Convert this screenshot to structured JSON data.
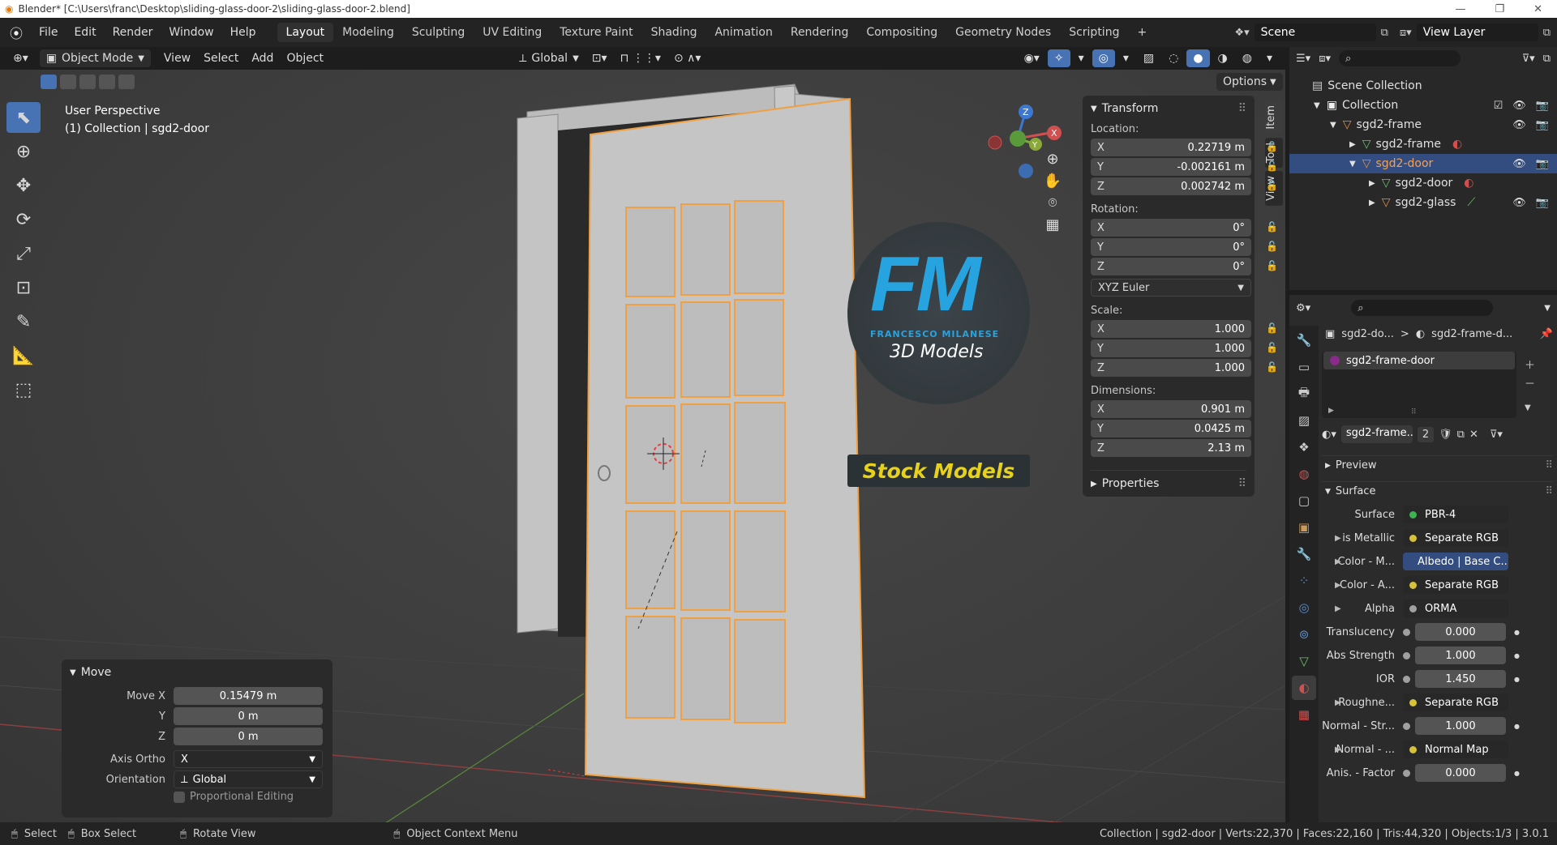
{
  "title_bar": {
    "text": "Blender* [C:\\Users\\franc\\Desktop\\sliding-glass-door-2\\sliding-glass-door-2.blend]",
    "minimize": "—",
    "maximize": "❐",
    "close": "✕"
  },
  "menu": [
    "File",
    "Edit",
    "Render",
    "Window",
    "Help"
  ],
  "workspaces": [
    "Layout",
    "Modeling",
    "Sculpting",
    "UV Editing",
    "Texture Paint",
    "Shading",
    "Animation",
    "Rendering",
    "Compositing",
    "Geometry Nodes",
    "Scripting"
  ],
  "active_workspace": "Layout",
  "add_workspace": "+",
  "scene": {
    "name": "Scene",
    "view_layer": "View Layer"
  },
  "header": {
    "mode": "Object Mode",
    "items": [
      "View",
      "Select",
      "Add",
      "Object"
    ],
    "orientation": "Global",
    "options": "Options"
  },
  "viewport": {
    "perspective": "User Perspective",
    "collection": "(1) Collection | sgd2-door"
  },
  "watermark": {
    "big": "FM",
    "sub": "FRANCESCO MILANESE",
    "line": "3D Models",
    "badge": "Stock Models"
  },
  "gizmo": {
    "z": "Z",
    "y": "Y",
    "x": "X"
  },
  "npanel": {
    "tabs": [
      "Item",
      "Tool",
      "View"
    ],
    "transform_label": "Transform",
    "location_label": "Location:",
    "location": [
      {
        "axis": "X",
        "value": "0.22719 m"
      },
      {
        "axis": "Y",
        "value": "-0.002161 m"
      },
      {
        "axis": "Z",
        "value": "0.002742 m"
      }
    ],
    "rotation_label": "Rotation:",
    "rotation": [
      {
        "axis": "X",
        "value": "0°"
      },
      {
        "axis": "Y",
        "value": "0°"
      },
      {
        "axis": "Z",
        "value": "0°"
      }
    ],
    "rotation_mode": "XYZ Euler",
    "scale_label": "Scale:",
    "scale": [
      {
        "axis": "X",
        "value": "1.000"
      },
      {
        "axis": "Y",
        "value": "1.000"
      },
      {
        "axis": "Z",
        "value": "1.000"
      }
    ],
    "dimensions_label": "Dimensions:",
    "dimensions": [
      {
        "axis": "X",
        "value": "0.901 m"
      },
      {
        "axis": "Y",
        "value": "0.0425 m"
      },
      {
        "axis": "Z",
        "value": "2.13 m"
      }
    ],
    "properties_label": "Properties"
  },
  "move_panel": {
    "title": "Move",
    "move_x_label": "Move X",
    "move_x": "0.15479 m",
    "y_label": "Y",
    "y": "0 m",
    "z_label": "Z",
    "z": "0 m",
    "axis_ortho_label": "Axis Ortho",
    "axis_ortho": "X",
    "orientation_label": "Orientation",
    "orientation": "Global",
    "proportional": "Proportional Editing"
  },
  "outliner": {
    "rows": [
      {
        "label": "Scene Collection",
        "indent": 0
      },
      {
        "label": "Collection",
        "indent": 1
      },
      {
        "label": "sgd2-frame",
        "indent": 2
      },
      {
        "label": "sgd2-frame",
        "indent": 3
      },
      {
        "label": "sgd2-door",
        "indent": 3,
        "selected": true
      },
      {
        "label": "sgd2-door",
        "indent": 4
      },
      {
        "label": "sgd2-glass",
        "indent": 4
      }
    ]
  },
  "properties": {
    "breadcrumb_obj": "sgd2-do...",
    "breadcrumb_sep": ">",
    "breadcrumb_mat": "sgd2-frame-d...",
    "slot": "sgd2-frame-door",
    "material_name": "sgd2-frame...",
    "users": "2",
    "preview": "Preview",
    "surface_section": "Surface",
    "rows": [
      {
        "label": "Surface",
        "value": "PBR-4",
        "dot": "#3fb34f",
        "numeric": false,
        "expand": false
      },
      {
        "label": "is Metallic",
        "value": "Separate RGB",
        "dot": "#d6c13a",
        "numeric": false,
        "expand": true
      },
      {
        "label": "Color - M...",
        "value": "Albedo | Base C...",
        "dot": "#d6c13a",
        "numeric": false,
        "expand": true,
        "highlight": true
      },
      {
        "label": "Color - A...",
        "value": "Separate RGB",
        "dot": "#d6c13a",
        "numeric": false,
        "expand": true
      },
      {
        "label": "Alpha",
        "value": "ORMA",
        "dot": "#a0a0a0",
        "numeric": false,
        "expand": true
      },
      {
        "label": "Translucency",
        "value": "0.000",
        "dot": "#a0a0a0",
        "numeric": true,
        "expand": false
      },
      {
        "label": "Abs Strength",
        "value": "1.000",
        "dot": "#a0a0a0",
        "numeric": true,
        "expand": false
      },
      {
        "label": "IOR",
        "value": "1.450",
        "dot": "#a0a0a0",
        "numeric": true,
        "expand": false
      },
      {
        "label": "Roughne...",
        "value": "Separate RGB",
        "dot": "#d6c13a",
        "numeric": false,
        "expand": true
      },
      {
        "label": "Normal - Str...",
        "value": "1.000",
        "dot": "#a0a0a0",
        "numeric": true,
        "expand": false
      },
      {
        "label": "Normal - ...",
        "value": "Normal Map",
        "dot": "#d6c13a",
        "numeric": false,
        "expand": true
      },
      {
        "label": "Anis. - Factor",
        "value": "0.000",
        "dot": "#a0a0a0",
        "numeric": true,
        "expand": false
      }
    ]
  },
  "status": {
    "select": "Select",
    "box_select": "Box Select",
    "rotate": "Rotate View",
    "context": "Object Context Menu",
    "right": "Collection | sgd2-door | Verts:22,370 | Faces:22,160 | Tris:44,320 | Objects:1/3 | 3.0.1"
  },
  "colors": {
    "accent": "#4772b3",
    "selection_outline": "#f0a040",
    "watermark_blue": "#27a3e0",
    "badge_yellow": "#e6d21b"
  }
}
